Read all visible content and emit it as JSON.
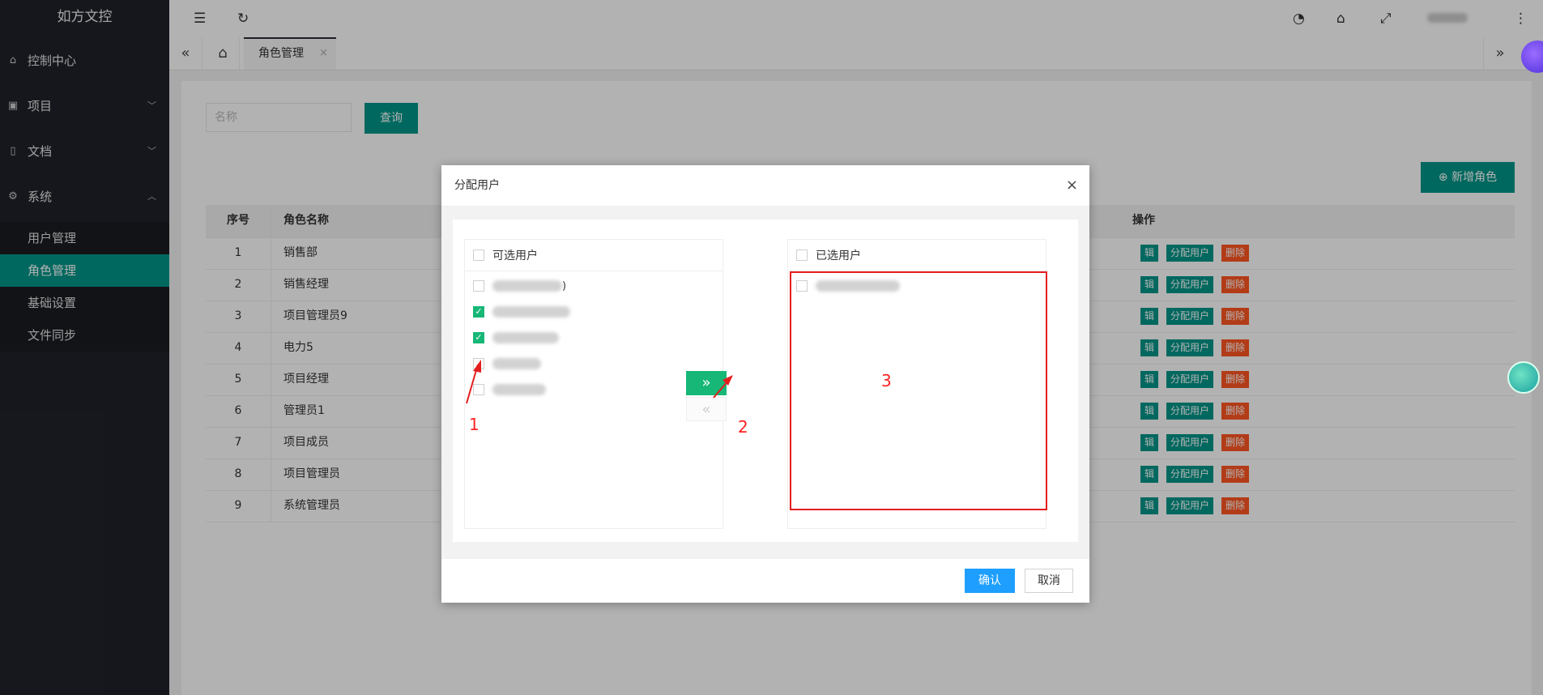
{
  "sidebar": {
    "brand": "如方文控",
    "items": [
      {
        "label": "控制中心",
        "icon": "home-icon"
      },
      {
        "label": "项目",
        "icon": "project-icon"
      },
      {
        "label": "文档",
        "icon": "document-icon"
      },
      {
        "label": "系统",
        "icon": "gear-icon"
      }
    ],
    "sub_items": [
      "用户管理",
      "角色管理",
      "基础设置",
      "文件同步"
    ]
  },
  "tabs": {
    "active": "角色管理",
    "close": "×"
  },
  "search": {
    "placeholder": "名称",
    "button": "查询"
  },
  "add_role_button": "新增角色",
  "table": {
    "headers": {
      "no": "序号",
      "name": "角色名称",
      "ops": "操作"
    },
    "rows": [
      {
        "no": "1",
        "name": "销售部"
      },
      {
        "no": "2",
        "name": "销售经理"
      },
      {
        "no": "3",
        "name": "项目管理员9"
      },
      {
        "no": "4",
        "name": "电力5"
      },
      {
        "no": "5",
        "name": "项目经理"
      },
      {
        "no": "6",
        "name": "管理员1"
      },
      {
        "no": "7",
        "name": "项目成员"
      },
      {
        "no": "8",
        "name": "项目管理员"
      },
      {
        "no": "9",
        "name": "系统管理员"
      }
    ],
    "op_edit": "辑",
    "op_assign": "分配用户",
    "op_delete": "删除"
  },
  "modal": {
    "title": "分配用户",
    "close": "×",
    "left_title": "可选用户",
    "right_title": "已选用户",
    "left_items": [
      {
        "checked": false,
        "suffix": ")"
      },
      {
        "checked": true,
        "suffix": ""
      },
      {
        "checked": true,
        "suffix": ""
      },
      {
        "checked": false,
        "suffix": ""
      },
      {
        "checked": false,
        "suffix": ""
      }
    ],
    "transfer_right": "»",
    "transfer_left": "«",
    "confirm": "确认",
    "cancel": "取消"
  },
  "annotations": {
    "a1": "1",
    "a2": "2",
    "a3": "3"
  },
  "colors": {
    "accent": "#009688",
    "danger": "#ff5722",
    "annotation": "#e41e1e",
    "confirm": "#1e9fff"
  }
}
